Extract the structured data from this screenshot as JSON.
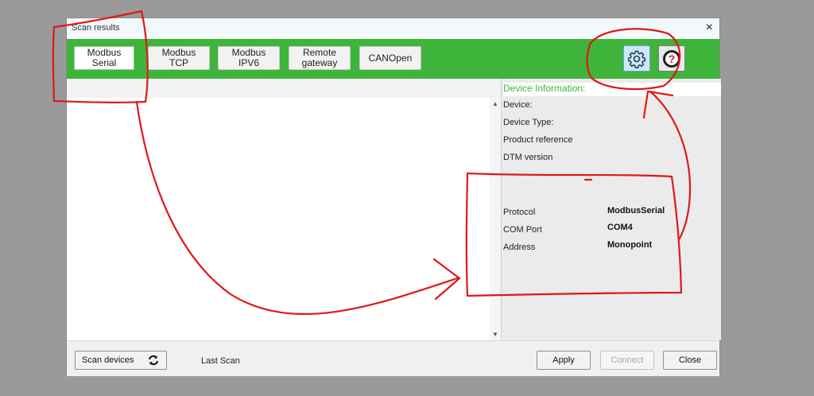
{
  "dialog": {
    "title": "Scan results",
    "close_label": "×"
  },
  "protocol_tabs": [
    {
      "label": "Modbus\nSerial",
      "active": true
    },
    {
      "label": "Modbus\nTCP",
      "active": false
    },
    {
      "label": "Modbus\nIPV6",
      "active": false
    },
    {
      "label": "Remote\ngateway",
      "active": false
    },
    {
      "label": "CANOpen",
      "active": false
    }
  ],
  "toolbar": {
    "settings_icon": "gear-icon",
    "help_icon": "question-icon",
    "help_glyph": "?"
  },
  "device_info": {
    "title": "Device Information:",
    "device_label": "Device:",
    "device_type_label": "Device Type:",
    "product_reference_label": "Product reference",
    "dtm_version_label": "DTM version",
    "protocol_label": "Protocol",
    "protocol_value": "ModbusSerial",
    "com_port_label": "COM Port",
    "com_port_value": "COM4",
    "address_label": "Address",
    "address_value": "Monopoint"
  },
  "footer": {
    "scan_devices_label": "Scan devices",
    "last_scan_label": "Last Scan",
    "apply_label": "Apply",
    "connect_label": "Connect",
    "close_label": "Close"
  },
  "colors": {
    "toolbar_green": "#3eb43a",
    "annotation_red": "#e01818"
  }
}
